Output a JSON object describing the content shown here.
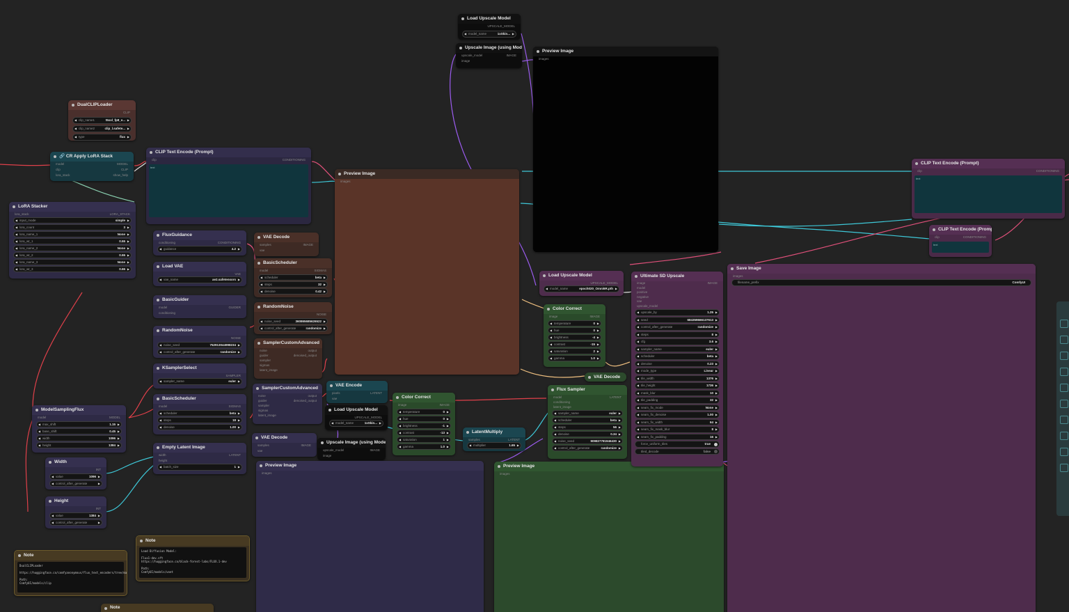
{
  "nodes": {
    "load_upscale_model_top": {
      "title": "Load Upscale Model",
      "output": "UPSCALE_MODEL",
      "w_model_name": {
        "label": "model_name",
        "value": "1xSkin..."
      }
    },
    "upscale_image_top": {
      "title": "Upscale Image (using Model)",
      "in_upscale_model": "upscale_model",
      "in_image": "image",
      "output": "IMAGE"
    },
    "preview_image_black": {
      "title": "Preview Image",
      "in_images": "images"
    },
    "dual_clip_loader": {
      "title": "DualCLIPLoader",
      "output": "CLIP",
      "w_clip_name1": {
        "label": "clip_name1",
        "value": "t5xxl_fp8_e..."
      },
      "w_clip_name2": {
        "label": "clip_name2",
        "value": "clip_l.safete..."
      },
      "w_type": {
        "label": "type",
        "value": "flux"
      }
    },
    "cr_apply_lora_stack": {
      "title": "🔗 CR Apply LoRA Stack",
      "in_model": "model",
      "in_clip": "clip",
      "in_lora_stack": "lora_stack",
      "out_model": "MODEL",
      "out_clip": "CLIP",
      "out_show_help": "show_help"
    },
    "clip_text_encode_left": {
      "title": "CLIP Text Encode (Prompt)",
      "in_clip": "clip",
      "output": "CONDITIONING",
      "text_label": "text"
    },
    "preview_image_brown": {
      "title": "Preview Image",
      "in_images": "images"
    },
    "clip_text_encode_right1": {
      "title": "CLIP Text Encode (Prompt)",
      "in_clip": "clip",
      "output": "CONDITIONING",
      "text_label": "text"
    },
    "clip_text_encode_right2": {
      "title": "CLIP Text Encode (Prompt)",
      "in_clip": "clip",
      "output": "CONDITIONING",
      "text_label": "text"
    },
    "lora_stacker": {
      "title": "LoRA Stacker",
      "in_lora_stack": "lora_stack",
      "output": "LORA_STACK",
      "widgets": [
        {
          "label": "input_mode",
          "value": "simple"
        },
        {
          "label": "lora_count",
          "value": "3"
        },
        {
          "label": "lora_name_1",
          "value": "None"
        },
        {
          "label": "lora_wt_1",
          "value": "0.55"
        },
        {
          "label": "lora_name_2",
          "value": "None"
        },
        {
          "label": "lora_wt_2",
          "value": "0.55"
        },
        {
          "label": "lora_name_3",
          "value": "None"
        },
        {
          "label": "lora_wt_3",
          "value": "0.55"
        }
      ]
    },
    "flux_guidance": {
      "title": "FluxGuidance",
      "in_conditioning": "conditioning",
      "output": "CONDITIONING",
      "w_guidance": {
        "label": "guidance",
        "value": "4.2"
      }
    },
    "vae_decode_1": {
      "title": "VAE Decode",
      "in_samples": "samples",
      "in_vae": "vae",
      "output": "IMAGE"
    },
    "load_vae": {
      "title": "Load VAE",
      "output": "VAE",
      "w_vae_name": {
        "label": "vae_name",
        "value": "ae2.safetensors"
      }
    },
    "basic_scheduler_1": {
      "title": "BasicScheduler",
      "in_model": "model",
      "output": "SIGMAS",
      "widgets": [
        {
          "label": "scheduler",
          "value": "beta"
        },
        {
          "label": "steps",
          "value": "32"
        },
        {
          "label": "denoise",
          "value": "0.42"
        }
      ]
    },
    "basic_guider": {
      "title": "BasicGuider",
      "in_model": "model",
      "in_conditioning": "conditioning",
      "output": "GUIDER"
    },
    "random_noise_1": {
      "title": "RandomNoise",
      "output": "NOISE",
      "widgets": [
        {
          "label": "noise_seed",
          "value": "360865685626522"
        },
        {
          "label": "control_after_generate",
          "value": "randomize"
        }
      ]
    },
    "random_noise_2": {
      "title": "RandomNoise",
      "output": "NOISE",
      "widgets": [
        {
          "label": "noise_seed",
          "value": "752913044998234"
        },
        {
          "label": "control_after_generate",
          "value": "randomize"
        }
      ]
    },
    "sampler_custom_adv_1": {
      "title": "SamplerCustomAdvanced",
      "inputs": [
        "noise",
        "guider",
        "sampler",
        "sigmas",
        "latent_image"
      ],
      "out_output": "output",
      "out_denoised": "denoised_output"
    },
    "ksampler_select": {
      "title": "KSamplerSelect",
      "output": "SAMPLER",
      "w_sampler_name": {
        "label": "sampler_name",
        "value": "euler"
      }
    },
    "sampler_custom_adv_2": {
      "title": "SamplerCustomAdvanced",
      "inputs": [
        "noise",
        "guider",
        "sampler",
        "sigmas",
        "latent_image"
      ],
      "out_output": "output",
      "out_denoised": "denoised_output"
    },
    "vae_encode": {
      "title": "VAE Encode",
      "in_pixels": "pixels",
      "in_vae": "vae",
      "output": "LATENT"
    },
    "load_upscale_model_mid": {
      "title": "Load Upscale Model",
      "output": "UPSCALE_MODEL",
      "w_model_name": {
        "label": "model_name",
        "value": "1xSkin..."
      }
    },
    "color_correct_1": {
      "title": "Color Correct",
      "in_image": "image",
      "output": "IMAGE",
      "widgets": [
        {
          "label": "temperature",
          "value": "0"
        },
        {
          "label": "hue",
          "value": "0"
        },
        {
          "label": "brightness",
          "value": "-1"
        },
        {
          "label": "contrast",
          "value": "-13"
        },
        {
          "label": "saturation",
          "value": "1"
        },
        {
          "label": "gamma",
          "value": "1.0"
        }
      ]
    },
    "model_sampling_flux": {
      "title": "ModelSamplingFlux",
      "in_model": "model",
      "output": "MODEL",
      "widgets": [
        {
          "label": "max_shift",
          "value": "1.15"
        },
        {
          "label": "base_shift",
          "value": "0.45"
        },
        {
          "label": "width",
          "value": "1096"
        },
        {
          "label": "height",
          "value": "1384"
        }
      ]
    },
    "basic_scheduler_2": {
      "title": "BasicScheduler",
      "in_model": "model",
      "output": "SIGMAS",
      "widgets": [
        {
          "label": "scheduler",
          "value": "beta"
        },
        {
          "label": "steps",
          "value": "18"
        },
        {
          "label": "denoise",
          "value": "1.00"
        }
      ]
    },
    "vae_decode_2": {
      "title": "VAE Decode",
      "in_samples": "samples",
      "in_vae": "vae",
      "output": "IMAGE"
    },
    "upscale_image_mid": {
      "title": "Upscale Image (using Model)",
      "in_upscale_model": "upscale_model",
      "in_image": "image",
      "output": "IMAGE"
    },
    "latent_multiply": {
      "title": "LatentMultiply",
      "in_samples": "samples",
      "output": "LATENT",
      "w_multiplier": {
        "label": "multiplier",
        "value": "1.65"
      }
    },
    "empty_latent_image": {
      "title": "Empty Latent Image",
      "in_width": "width",
      "in_height": "height",
      "output": "LATENT",
      "w_batch_size": {
        "label": "batch_size",
        "value": "1"
      }
    },
    "width": {
      "title": "Width",
      "output": "INT",
      "widgets": [
        {
          "label": "value",
          "value": "1096"
        },
        {
          "label": "control_after_generate",
          "value": ""
        }
      ]
    },
    "height": {
      "title": "Height",
      "output": "INT",
      "widgets": [
        {
          "label": "value",
          "value": "1384"
        },
        {
          "label": "control_after_generate",
          "value": ""
        }
      ]
    },
    "preview_image_purple": {
      "title": "Preview Image",
      "in_images": "images"
    },
    "preview_image_green": {
      "title": "Preview Image",
      "in_images": "images"
    },
    "load_upscale_model_right": {
      "title": "Load Upscale Model",
      "output": "UPSCALE_MODEL",
      "w_model_name": {
        "label": "model_name",
        "value": "epoch020_Omni6R.pth"
      }
    },
    "color_correct_2": {
      "title": "Color Correct",
      "in_image": "image",
      "output": "IMAGE",
      "widgets": [
        {
          "label": "temperature",
          "value": "0"
        },
        {
          "label": "hue",
          "value": "0"
        },
        {
          "label": "brightness",
          "value": "-4"
        },
        {
          "label": "contrast",
          "value": "-15"
        },
        {
          "label": "saturation",
          "value": "2"
        },
        {
          "label": "gamma",
          "value": "1.0"
        }
      ]
    },
    "vae_decode_3": {
      "title": "VAE Decode"
    },
    "flux_sampler": {
      "title": "Flux Sampler",
      "in_model": "model",
      "in_conditioning": "conditioning",
      "in_latent_image": "latent_image",
      "output": "LATENT",
      "widgets": [
        {
          "label": "sampler_name",
          "value": "euler"
        },
        {
          "label": "scheduler",
          "value": "beta"
        },
        {
          "label": "steps",
          "value": "56"
        },
        {
          "label": "denoise",
          "value": "0.34"
        },
        {
          "label": "noise_seed",
          "value": "909827781946430"
        },
        {
          "label": "control_after_generate",
          "value": "randomize"
        }
      ]
    },
    "ultimate_sd_upscale": {
      "title": "Ultimate SD Upscale",
      "inputs": [
        "image",
        "model",
        "positive",
        "negative",
        "vae",
        "upscale_model"
      ],
      "output": "IMAGE",
      "widgets": [
        {
          "label": "upscale_by",
          "value": "1.25"
        },
        {
          "label": "seed",
          "value": "684359666137613"
        },
        {
          "label": "control_after_generate",
          "value": "randomize"
        },
        {
          "label": "steps",
          "value": "8"
        },
        {
          "label": "cfg",
          "value": "3.6"
        },
        {
          "label": "sampler_name",
          "value": "euler"
        },
        {
          "label": "scheduler",
          "value": "beta"
        },
        {
          "label": "denoise",
          "value": "0.23"
        },
        {
          "label": "mode_type",
          "value": "Linear"
        },
        {
          "label": "tile_width",
          "value": "1376"
        },
        {
          "label": "tile_height",
          "value": "1736"
        },
        {
          "label": "mask_blur",
          "value": "10"
        },
        {
          "label": "tile_padding",
          "value": "32"
        },
        {
          "label": "seam_fix_mode",
          "value": "None"
        },
        {
          "label": "seam_fix_denoise",
          "value": "1.00"
        },
        {
          "label": "seam_fix_width",
          "value": "64"
        },
        {
          "label": "seam_fix_mask_blur",
          "value": "8"
        },
        {
          "label": "seam_fix_padding",
          "value": "16"
        },
        {
          "label": "force_uniform_tiles",
          "value": "true"
        },
        {
          "label": "tiled_decode",
          "value": "false"
        }
      ]
    },
    "save_image": {
      "title": "Save Image",
      "in_images": "images",
      "w_filename_prefix": {
        "label": "filename_prefix",
        "value": "ComfyUI"
      }
    },
    "note_1": {
      "title": "Note",
      "text": "DualCLIPLoader\n\nhttps://huggingface.co/comfyanonymous/flux_text_encoders/tree/main\n\nPath:\nComfyUI/models/clip"
    },
    "note_2": {
      "title": "Note",
      "text": "Load Diffusion Model:\n\nFlux1-dev.sft\nhttps://huggingface.co/black-forest-labs/FLUX.1-dev\n\nPath:\nComfyUI/models/unet"
    },
    "note_3": {
      "title": "Note"
    }
  },
  "colors": {
    "canvas": "#232323",
    "purple_node": "#2e2a45",
    "brown_node": "#4a2f26",
    "teal_node": "#163840",
    "green_node": "#2a4a2a",
    "magenta_node": "#4e2c4c",
    "wire_red": "#e0404a",
    "wire_cyan": "#3ec8d8",
    "wire_purple": "#9c5cf0",
    "wire_pink": "#e0507a",
    "wire_green": "#8ad0b0",
    "wire_orange": "#f0c080"
  }
}
